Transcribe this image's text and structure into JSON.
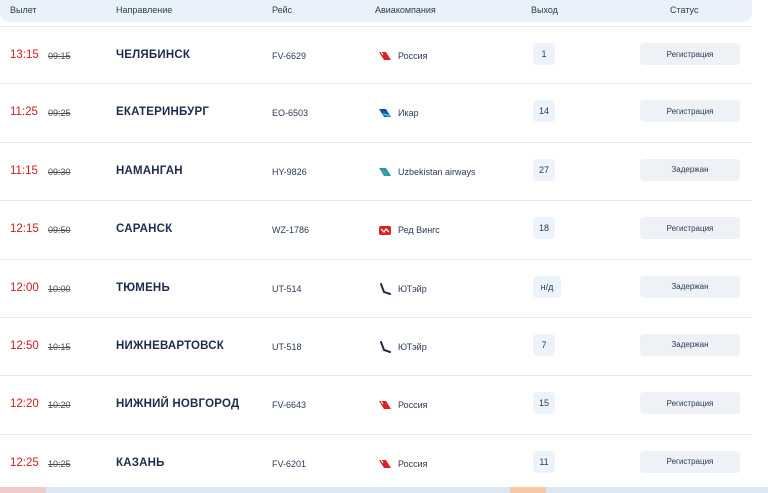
{
  "header": {
    "col_departure": "Вылет",
    "col_direction": "Направление",
    "col_flight": "Рейс",
    "col_airline": "Авиакомпания",
    "col_gate": "Выход",
    "col_status": "Статус"
  },
  "colors": {
    "delay_time": "#d11a1a",
    "header_bg": "#e9f1fb",
    "badge_bg": "#eef2f6"
  },
  "flights": [
    {
      "time": "13:15",
      "scheduled": "09:15",
      "city": "ЧЕЛЯБИНСК",
      "flight": "FV-6629",
      "airline": "Россия",
      "logo_icon": "rossiya-logo-icon",
      "gate": "1",
      "status": "Регистрация"
    },
    {
      "time": "11:25",
      "scheduled": "09:25",
      "city": "ЕКАТЕРИНБУРГ",
      "flight": "EO-6503",
      "airline": "Икар",
      "logo_icon": "ikar-logo-icon",
      "gate": "14",
      "status": "Регистрация"
    },
    {
      "time": "11:15",
      "scheduled": "09:30",
      "city": "НАМАНГАН",
      "flight": "HY-9826",
      "airline": "Uzbekistan airways",
      "logo_icon": "uzbekistan-airways-logo-icon",
      "gate": "27",
      "status": "Задержан"
    },
    {
      "time": "12:15",
      "scheduled": "09:50",
      "city": "САРАНСК",
      "flight": "WZ-1786",
      "airline": "Ред Вингс",
      "logo_icon": "red-wings-logo-icon",
      "gate": "18",
      "status": "Регистрация"
    },
    {
      "time": "12:00",
      "scheduled": "10:00",
      "city": "ТЮМЕНЬ",
      "flight": "UT-514",
      "airline": "ЮТэйр",
      "logo_icon": "utair-logo-icon",
      "gate": "н/д",
      "status": "Задержан"
    },
    {
      "time": "12:50",
      "scheduled": "10:15",
      "city": "НИЖНЕВАРТОВСК",
      "flight": "UT-518",
      "airline": "ЮТэйр",
      "logo_icon": "utair-logo-icon",
      "gate": "7",
      "status": "Задержан"
    },
    {
      "time": "12:20",
      "scheduled": "10:20",
      "city": "НИЖНИЙ НОВГОРОД",
      "flight": "FV-6643",
      "airline": "Россия",
      "logo_icon": "rossiya-logo-icon",
      "gate": "15",
      "status": "Регистрация"
    },
    {
      "time": "12:25",
      "scheduled": "10:25",
      "city": "КАЗАНЬ",
      "flight": "FV-6201",
      "airline": "Россия",
      "logo_icon": "rossiya-logo-icon",
      "gate": "11",
      "status": "Регистрация"
    }
  ]
}
